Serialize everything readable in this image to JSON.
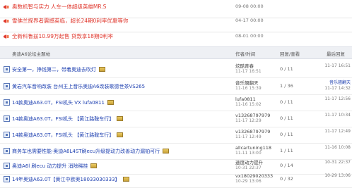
{
  "promos": [
    {
      "title": "奥数机智与实力 人车一体超级英雄MR.S",
      "date": "09-08 00:00",
      "color": "#e0382e"
    },
    {
      "title": "雪佛兰探界者震撼英临，超长24期0利率优惠等你",
      "date": "04-17 00:00",
      "color": "#e0382e"
    },
    {
      "title": "全新科鲁兹10.99万起售 贷款享18期0利率",
      "date": "08-01 00:00",
      "color": "#e0382e"
    }
  ],
  "table_header": {
    "topic": "奥迪A6论坛主题帖",
    "author": "作者/时间",
    "stats": "回复/查看",
    "last": "最后回复"
  },
  "rows": [
    {
      "title": "安全第一，挣钱第二，带着奥迪去吹灯",
      "has_image": true,
      "author": "炫酷青春",
      "date": "11-17 16:51",
      "stats": "0 / 11",
      "last_user": "",
      "last_time": "11-17 16:51"
    },
    {
      "title": "黄岩汽车音响改装 台州王上音乐奥迪A6改装歌德世茶VS265",
      "has_image": false,
      "author": "音乐翘翻天",
      "date": "11-16 15:39",
      "stats": "1 / 36",
      "last_user": "音乐翘翻天",
      "last_time": "11-17 14:32"
    },
    {
      "title": "14款奥迪A63.0T，FSI机头 VX lufa0811",
      "has_image": true,
      "author": "lufa0811",
      "date": "11-16 15:02",
      "stats": "0 / 11",
      "last_user": "",
      "last_time": "11-17 12:56"
    },
    {
      "title": "14款奥迪A63.0T，FSI机头 【黄江路鞍车行】",
      "has_image": true,
      "author": "v13268797979",
      "date": "11-17 12:29",
      "stats": "0 / 11",
      "last_user": "",
      "last_time": "11-17 10:34"
    },
    {
      "title": "14款奥迪A63.0T，FSI机头 【黄江路鞍车行】",
      "has_image": true,
      "author": "v13268797979",
      "date": "11-17 12:49",
      "stats": "0 / 11",
      "last_user": "",
      "last_time": "11-17 12:49"
    },
    {
      "title": "商务车也需要性能·奥迪A6L4ST刷ecu升级提动力改善动力漏铂可行",
      "has_image": true,
      "author": "allcartuning118",
      "date": "11-11 13:00",
      "stats": "1 / 11",
      "last_user": "",
      "last_time": "11-16 10:08"
    },
    {
      "title": "奥迪A6l 刷ecu 动力提升 消除稀挂",
      "has_image": true,
      "author": "速度动力提升",
      "date": "10-31 22:37",
      "stats": "0 / 14",
      "last_user": "",
      "last_time": "10-31 22:37"
    },
    {
      "title": "14年奥迪A63.0T【黄江中欧奥18033030333】",
      "has_image": true,
      "author": "vx18029020333",
      "date": "10-29 13:06",
      "stats": "0 / 32",
      "last_user": "",
      "last_time": "10-29 13:06"
    }
  ]
}
